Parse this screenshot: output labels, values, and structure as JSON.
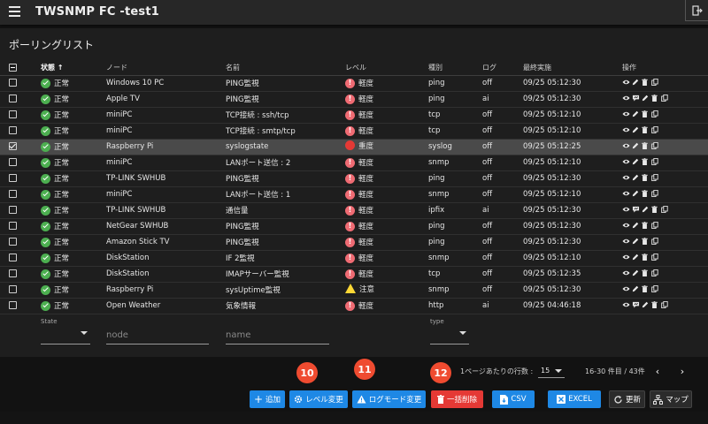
{
  "app": {
    "title": "TWSNMP FC -test1"
  },
  "page": {
    "title": "ポーリングリスト"
  },
  "columns": {
    "state": "状態 ↑",
    "node": "ノード",
    "name": "名前",
    "level": "レベル",
    "type": "種別",
    "log": "ログ",
    "last": "最終実施",
    "ops": "操作"
  },
  "rows": [
    {
      "state": "正常",
      "node": "Windows 10 PC",
      "name": "PING監視",
      "level": "軽度",
      "level_kind": "low",
      "type": "ping",
      "log": "off",
      "last": "09/25 05:12:30",
      "ops": [
        "eye",
        "pencil",
        "trash",
        "copy"
      ]
    },
    {
      "state": "正常",
      "node": "Apple TV",
      "name": "PING監視",
      "level": "軽度",
      "level_kind": "low",
      "type": "ping",
      "log": "ai",
      "last": "09/25 05:12:30",
      "ops": [
        "eye",
        "chart",
        "pencil",
        "trash",
        "copy"
      ]
    },
    {
      "state": "正常",
      "node": "miniPC",
      "name": "TCP接続 : ssh/tcp",
      "level": "軽度",
      "level_kind": "low",
      "type": "tcp",
      "log": "off",
      "last": "09/25 05:12:10",
      "ops": [
        "eye",
        "pencil",
        "trash",
        "copy"
      ]
    },
    {
      "state": "正常",
      "node": "miniPC",
      "name": "TCP接続 : smtp/tcp",
      "level": "軽度",
      "level_kind": "low",
      "type": "tcp",
      "log": "off",
      "last": "09/25 05:12:10",
      "ops": [
        "eye",
        "pencil",
        "trash",
        "copy"
      ]
    },
    {
      "state": "正常",
      "node": "Raspberry Pi",
      "name": "syslogstate",
      "level": "重度",
      "level_kind": "high",
      "type": "syslog",
      "log": "off",
      "last": "09/25 05:12:25",
      "ops": [
        "eye",
        "pencil",
        "trash",
        "copy"
      ],
      "selected": true
    },
    {
      "state": "正常",
      "node": "miniPC",
      "name": "LANポート送信 : 2",
      "level": "軽度",
      "level_kind": "low",
      "type": "snmp",
      "log": "off",
      "last": "09/25 05:12:10",
      "ops": [
        "eye",
        "pencil",
        "trash",
        "copy"
      ]
    },
    {
      "state": "正常",
      "node": "TP-LINK SWHUB",
      "name": "PING監視",
      "level": "軽度",
      "level_kind": "low",
      "type": "ping",
      "log": "off",
      "last": "09/25 05:12:30",
      "ops": [
        "eye",
        "pencil",
        "trash",
        "copy"
      ]
    },
    {
      "state": "正常",
      "node": "miniPC",
      "name": "LANポート送信 : 1",
      "level": "軽度",
      "level_kind": "low",
      "type": "snmp",
      "log": "off",
      "last": "09/25 05:12:10",
      "ops": [
        "eye",
        "pencil",
        "trash",
        "copy"
      ]
    },
    {
      "state": "正常",
      "node": "TP-LINK SWHUB",
      "name": "通信量",
      "level": "軽度",
      "level_kind": "low",
      "type": "ipfix",
      "log": "ai",
      "last": "09/25 05:12:30",
      "ops": [
        "eye",
        "chart",
        "pencil",
        "trash",
        "copy"
      ]
    },
    {
      "state": "正常",
      "node": "NetGear SWHUB",
      "name": "PING監視",
      "level": "軽度",
      "level_kind": "low",
      "type": "ping",
      "log": "off",
      "last": "09/25 05:12:30",
      "ops": [
        "eye",
        "pencil",
        "trash",
        "copy"
      ]
    },
    {
      "state": "正常",
      "node": "Amazon Stick TV",
      "name": "PING監視",
      "level": "軽度",
      "level_kind": "low",
      "type": "ping",
      "log": "off",
      "last": "09/25 05:12:30",
      "ops": [
        "eye",
        "pencil",
        "trash",
        "copy"
      ]
    },
    {
      "state": "正常",
      "node": "DiskStation",
      "name": "IF 2監視",
      "level": "軽度",
      "level_kind": "low",
      "type": "snmp",
      "log": "off",
      "last": "09/25 05:12:10",
      "ops": [
        "eye",
        "pencil",
        "trash",
        "copy"
      ]
    },
    {
      "state": "正常",
      "node": "DiskStation",
      "name": "IMAPサーバー監視",
      "level": "軽度",
      "level_kind": "low",
      "type": "tcp",
      "log": "off",
      "last": "09/25 05:12:35",
      "ops": [
        "eye",
        "pencil",
        "trash",
        "copy"
      ]
    },
    {
      "state": "正常",
      "node": "Raspberry Pi",
      "name": "sysUptime監視",
      "level": "注意",
      "level_kind": "warn",
      "type": "snmp",
      "log": "off",
      "last": "09/25 05:12:30",
      "ops": [
        "eye",
        "pencil",
        "trash",
        "copy"
      ]
    },
    {
      "state": "正常",
      "node": "Open Weather",
      "name": "気象情報",
      "level": "軽度",
      "level_kind": "low",
      "type": "http",
      "log": "ai",
      "last": "09/25 04:46:18",
      "ops": [
        "eye",
        "chart",
        "pencil",
        "trash",
        "copy"
      ]
    }
  ],
  "filters": {
    "state_label": "State",
    "node_placeholder": "node",
    "name_placeholder": "name",
    "type_label": "type"
  },
  "pagination": {
    "rows_label": "1ページあたりの行数 :",
    "rows_value": "15",
    "range": "16-30 件目 / 43件"
  },
  "badges": [
    "10",
    "11",
    "12"
  ],
  "buttons": {
    "add": "追加",
    "level_change": "レベル変更",
    "log_mode_change": "ログモード変更",
    "bulk_delete": "一括削除",
    "csv": "CSV",
    "excel": "EXCEL",
    "refresh": "更新",
    "map": "マップ"
  },
  "colors": {
    "ok": "#4caf50",
    "level_low": "#ef6b73",
    "level_high": "#e53935",
    "level_warn": "#fdd835",
    "primary": "#1e88e5",
    "danger": "#e53935",
    "badge": "#ef4b30"
  }
}
